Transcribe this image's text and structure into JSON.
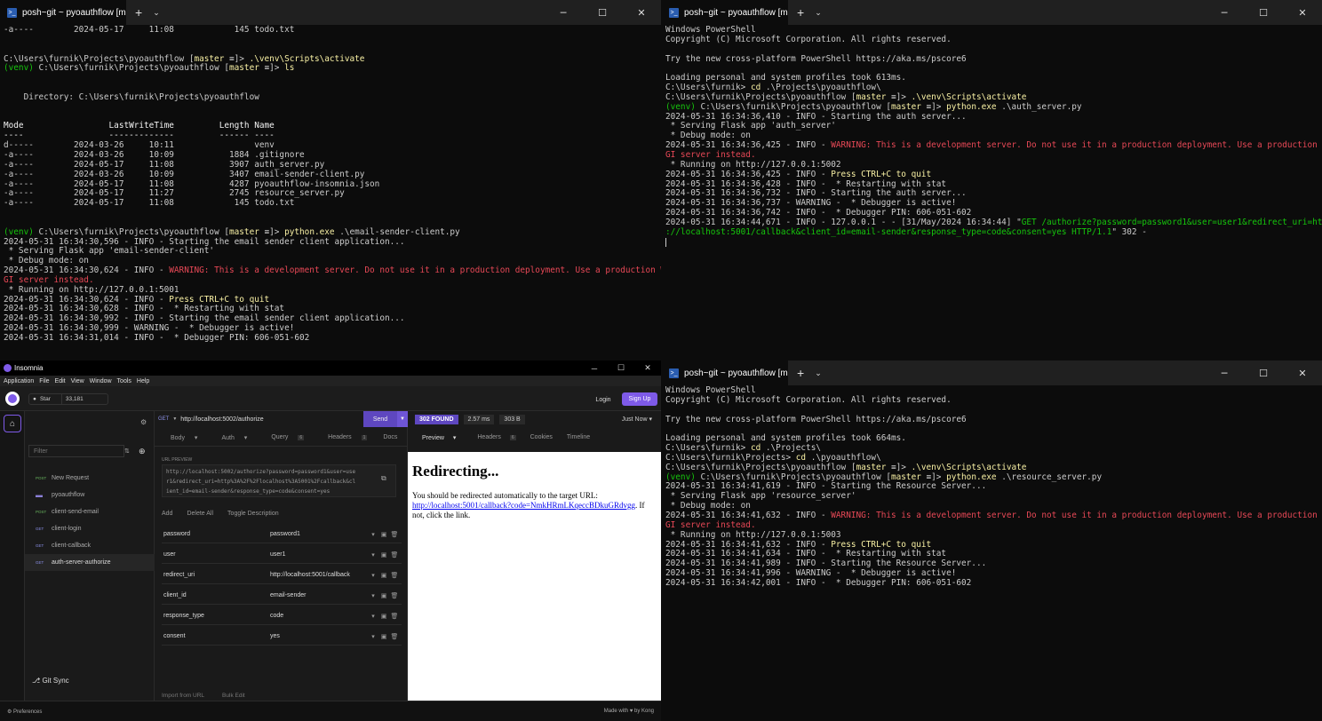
{
  "top_left": {
    "tab_title": "posh~git ~ pyoauthflow [mas",
    "lines": [
      [
        [
          "-a----        2024-05-17     11:08            145 todo.txt",
          ""
        ]
      ],
      [
        [
          "",
          ""
        ]
      ],
      [
        [
          "",
          ""
        ]
      ],
      [
        [
          "C:\\Users\\furnik\\Projects\\pyoauthflow [",
          ""
        ],
        [
          "master",
          "y"
        ],
        [
          " ≡]> ",
          ""
        ],
        [
          ".\\venv\\Scripts\\activate",
          "y"
        ]
      ],
      [
        [
          "(venv) ",
          "g"
        ],
        [
          "C:\\Users\\furnik\\Projects\\pyoauthflow [",
          ""
        ],
        [
          "master",
          "y"
        ],
        [
          " ≡]> ",
          ""
        ],
        [
          "ls",
          "y"
        ]
      ],
      [
        [
          "",
          ""
        ]
      ],
      [
        [
          "",
          ""
        ]
      ],
      [
        [
          "    Directory: C:\\Users\\furnik\\Projects\\pyoauthflow",
          ""
        ]
      ],
      [
        [
          "",
          ""
        ]
      ],
      [
        [
          "",
          ""
        ]
      ],
      [
        [
          "Mode                 LastWriteTime         Length Name",
          "w"
        ]
      ],
      [
        [
          "----                 -------------         ------ ----",
          "w"
        ]
      ],
      [
        [
          "d-----        2024-03-26     10:11                venv",
          ""
        ]
      ],
      [
        [
          "-a----        2024-03-26     10:09           1884 .gitignore",
          ""
        ]
      ],
      [
        [
          "-a----        2024-05-17     11:08           3907 auth_server.py",
          ""
        ]
      ],
      [
        [
          "-a----        2024-03-26     10:09           3407 email-sender-client.py",
          ""
        ]
      ],
      [
        [
          "-a----        2024-05-17     11:08           4287 pyoauthflow-insomnia.json",
          ""
        ]
      ],
      [
        [
          "-a----        2024-05-17     11:27           2745 resource_server.py",
          ""
        ]
      ],
      [
        [
          "-a----        2024-05-17     11:08            145 todo.txt",
          ""
        ]
      ],
      [
        [
          "",
          ""
        ]
      ],
      [
        [
          "",
          ""
        ]
      ],
      [
        [
          "(venv) ",
          "g"
        ],
        [
          "C:\\Users\\furnik\\Projects\\pyoauthflow [",
          ""
        ],
        [
          "master",
          "y"
        ],
        [
          " ≡]> ",
          ""
        ],
        [
          "python.exe",
          "y"
        ],
        [
          " .\\email-sender-client.py",
          ""
        ]
      ],
      [
        [
          "2024-05-31 16:34:30,596 - INFO - Starting the email sender client application...",
          ""
        ]
      ],
      [
        [
          " * Serving Flask app 'email-sender-client'",
          ""
        ]
      ],
      [
        [
          " * Debug mode: on",
          ""
        ]
      ],
      [
        [
          "2024-05-31 16:34:30,624 - INFO - ",
          ""
        ],
        [
          "WARNING: This is a development server. Do not use it in a production deployment. Use a production WS",
          "r"
        ]
      ],
      [
        [
          "GI server instead.",
          "r"
        ]
      ],
      [
        [
          " * Running on http://127.0.0.1:5001",
          ""
        ]
      ],
      [
        [
          "2024-05-31 16:34:30,624 - INFO - ",
          ""
        ],
        [
          "Press CTRL+C to quit",
          "y"
        ]
      ],
      [
        [
          "2024-05-31 16:34:30,628 - INFO -  * Restarting with stat",
          ""
        ]
      ],
      [
        [
          "2024-05-31 16:34:30,992 - INFO - Starting the email sender client application...",
          ""
        ]
      ],
      [
        [
          "2024-05-31 16:34:30,999 - WARNING -  * Debugger is active!",
          ""
        ]
      ],
      [
        [
          "2024-05-31 16:34:31,014 - INFO -  * Debugger PIN: 606-051-602",
          ""
        ]
      ]
    ]
  },
  "top_right": {
    "tab_title": "posh~git ~ pyoauthflow [mas",
    "lines": [
      [
        [
          "Windows PowerShell",
          ""
        ]
      ],
      [
        [
          "Copyright (C) Microsoft Corporation. All rights reserved.",
          ""
        ]
      ],
      [
        [
          "",
          ""
        ]
      ],
      [
        [
          "Try the new cross-platform PowerShell https://aka.ms/pscore6",
          ""
        ]
      ],
      [
        [
          "",
          ""
        ]
      ],
      [
        [
          "Loading personal and system profiles took 613ms.",
          ""
        ]
      ],
      [
        [
          "C:\\Users\\furnik> ",
          ""
        ],
        [
          "cd",
          "y"
        ],
        [
          " .\\Projects\\pyoauthflow\\",
          ""
        ]
      ],
      [
        [
          "C:\\Users\\furnik\\Projects\\pyoauthflow [",
          ""
        ],
        [
          "master",
          "y"
        ],
        [
          " ≡]> ",
          ""
        ],
        [
          ".\\venv\\Scripts\\activate",
          "y"
        ]
      ],
      [
        [
          "(venv) ",
          "g"
        ],
        [
          "C:\\Users\\furnik\\Projects\\pyoauthflow [",
          ""
        ],
        [
          "master",
          "y"
        ],
        [
          " ≡]> ",
          ""
        ],
        [
          "python.exe",
          "y"
        ],
        [
          " .\\auth_server.py",
          ""
        ]
      ],
      [
        [
          "2024-05-31 16:34:36,410 - INFO - Starting the auth server...",
          ""
        ]
      ],
      [
        [
          " * Serving Flask app 'auth_server'",
          ""
        ]
      ],
      [
        [
          " * Debug mode: on",
          ""
        ]
      ],
      [
        [
          "2024-05-31 16:34:36,425 - INFO - ",
          ""
        ],
        [
          "WARNING: This is a development server. Do not use it in a production deployment. Use a production WS",
          "r"
        ]
      ],
      [
        [
          "GI server instead.",
          "r"
        ]
      ],
      [
        [
          " * Running on http://127.0.0.1:5002",
          ""
        ]
      ],
      [
        [
          "2024-05-31 16:34:36,425 - INFO - ",
          ""
        ],
        [
          "Press CTRL+C to quit",
          "y"
        ]
      ],
      [
        [
          "2024-05-31 16:34:36,428 - INFO -  * Restarting with stat",
          ""
        ]
      ],
      [
        [
          "2024-05-31 16:34:36,732 - INFO - Starting the auth server...",
          ""
        ]
      ],
      [
        [
          "2024-05-31 16:34:36,737 - WARNING -  * Debugger is active!",
          ""
        ]
      ],
      [
        [
          "2024-05-31 16:34:36,742 - INFO -  * Debugger PIN: 606-051-602",
          ""
        ]
      ],
      [
        [
          "2024-05-31 16:34:44,671 - INFO - 127.0.0.1 - - [31/May/2024 16:34:44] \"",
          ""
        ],
        [
          "GET /authorize?password=password1&user=user1&redirect_uri=http",
          "g"
        ]
      ],
      [
        [
          "://localhost:5001/callback&client_id=email-sender&response_type=code&consent=yes HTTP/1.1",
          "g"
        ],
        [
          "\" 302 -",
          ""
        ]
      ]
    ]
  },
  "bottom_right": {
    "tab_title": "posh~git ~ pyoauthflow [mas",
    "lines": [
      [
        [
          "Windows PowerShell",
          ""
        ]
      ],
      [
        [
          "Copyright (C) Microsoft Corporation. All rights reserved.",
          ""
        ]
      ],
      [
        [
          "",
          ""
        ]
      ],
      [
        [
          "Try the new cross-platform PowerShell https://aka.ms/pscore6",
          ""
        ]
      ],
      [
        [
          "",
          ""
        ]
      ],
      [
        [
          "Loading personal and system profiles took 664ms.",
          ""
        ]
      ],
      [
        [
          "C:\\Users\\furnik> ",
          ""
        ],
        [
          "cd",
          "y"
        ],
        [
          " .\\Projects\\",
          ""
        ]
      ],
      [
        [
          "C:\\Users\\furnik\\Projects> ",
          ""
        ],
        [
          "cd",
          "y"
        ],
        [
          " .\\pyoauthflow\\",
          ""
        ]
      ],
      [
        [
          "C:\\Users\\furnik\\Projects\\pyoauthflow [",
          ""
        ],
        [
          "master",
          "y"
        ],
        [
          " ≡]> ",
          ""
        ],
        [
          ".\\venv\\Scripts\\activate",
          "y"
        ]
      ],
      [
        [
          "(venv) ",
          "g"
        ],
        [
          "C:\\Users\\furnik\\Projects\\pyoauthflow [",
          ""
        ],
        [
          "master",
          "y"
        ],
        [
          " ≡]> ",
          ""
        ],
        [
          "python.exe",
          "y"
        ],
        [
          " .\\resource_server.py",
          ""
        ]
      ],
      [
        [
          "2024-05-31 16:34:41,619 - INFO - Starting the Resource Server...",
          ""
        ]
      ],
      [
        [
          " * Serving Flask app 'resource_server'",
          ""
        ]
      ],
      [
        [
          " * Debug mode: on",
          ""
        ]
      ],
      [
        [
          "2024-05-31 16:34:41,632 - INFO - ",
          ""
        ],
        [
          "WARNING: This is a development server. Do not use it in a production deployment. Use a production WS",
          "r"
        ]
      ],
      [
        [
          "GI server instead.",
          "r"
        ]
      ],
      [
        [
          " * Running on http://127.0.0.1:5003",
          ""
        ]
      ],
      [
        [
          "2024-05-31 16:34:41,632 - INFO - ",
          ""
        ],
        [
          "Press CTRL+C to quit",
          "y"
        ]
      ],
      [
        [
          "2024-05-31 16:34:41,634 - INFO -  * Restarting with stat",
          ""
        ]
      ],
      [
        [
          "2024-05-31 16:34:41,989 - INFO - Starting the Resource Server...",
          ""
        ]
      ],
      [
        [
          "2024-05-31 16:34:41,996 - WARNING -  * Debugger is active!",
          ""
        ]
      ],
      [
        [
          "2024-05-31 16:34:42,001 - INFO -  * Debugger PIN: 606-051-602",
          ""
        ]
      ]
    ]
  },
  "insomnia": {
    "window_title": "Insomnia",
    "menu": [
      "Application",
      "File",
      "Edit",
      "View",
      "Window",
      "Tools",
      "Help"
    ],
    "star_label": "Star",
    "star_count": "33,181",
    "login": "Login",
    "signup": "Sign Up",
    "filter_placeholder": "Filter",
    "sidebar": [
      {
        "method": "POST",
        "label": "New Request"
      },
      {
        "method": "",
        "label": "pyoauthflow"
      },
      {
        "method": "POST",
        "label": "client-send-email"
      },
      {
        "method": "GET",
        "label": "client-login"
      },
      {
        "method": "GET",
        "label": "client-callback"
      },
      {
        "method": "GET",
        "label": "auth-server-authorize"
      }
    ],
    "git_sync": "Git Sync",
    "preferences": "Preferences",
    "made_with": "Made with ♥ by Kong",
    "method": "GET",
    "url": "http://localhost:5002/authorize",
    "send": "Send",
    "req_tabs": {
      "body": "Body",
      "auth": "Auth",
      "query": "Query",
      "query_count": "6",
      "headers": "Headers",
      "headers_count": "1",
      "docs": "Docs"
    },
    "url_preview_label": "URL PREVIEW",
    "url_preview_lines": [
      "http://localhost:5002/authorize?password=password1&user=use",
      "r1&redirect_uri=http%3A%2F%2Flocalhost%3A5001%2Fcallback&cl",
      "ient_id=email-sender&response_type=code&consent=yes"
    ],
    "add": "Add",
    "delete_all": "Delete All",
    "toggle_desc": "Toggle Description",
    "params": [
      {
        "key": "password",
        "value": "password1"
      },
      {
        "key": "user",
        "value": "user1"
      },
      {
        "key": "redirect_uri",
        "value": "http://localhost:5001/callback"
      },
      {
        "key": "client_id",
        "value": "email-sender"
      },
      {
        "key": "response_type",
        "value": "code"
      },
      {
        "key": "consent",
        "value": "yes"
      }
    ],
    "import_url": "Import from URL",
    "bulk_edit": "Bulk Edit",
    "status": "302 FOUND",
    "time": "2.57 ms",
    "size": "303 B",
    "when": "Just Now",
    "res_tabs": {
      "preview": "Preview",
      "headers": "Headers",
      "headers_count": "6",
      "cookies": "Cookies",
      "timeline": "Timeline"
    },
    "preview_title": "Redirecting...",
    "preview_text_1": "You should be redirected automatically to the target URL: ",
    "preview_link": "http://localhost:5001/callback?code=NmkHRmLKqeccBDkuGRdvgg",
    "preview_text_2": ". If not, click the link."
  }
}
